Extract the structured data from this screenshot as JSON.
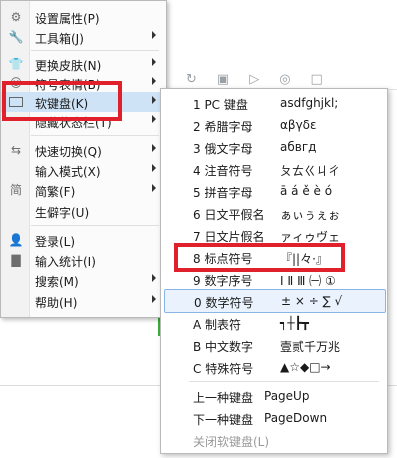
{
  "colors": {
    "highlight": "#e0202b",
    "selected_border": "#8ab4e6",
    "active_bg": "#cfe3f6"
  },
  "main_menu": {
    "items": [
      {
        "icon": "gear-icon",
        "label": "设置属性(P)",
        "submenu": false
      },
      {
        "icon": "wrench-icon",
        "label": "工具箱(J)",
        "submenu": true
      },
      {
        "icon": "shirt-icon",
        "label": "更换皮肤(N)",
        "submenu": true
      },
      {
        "icon": "emoji-icon",
        "label": "符号表情(B)",
        "submenu": true
      },
      {
        "icon": "keyboard-icon",
        "label": "软键盘(K)",
        "submenu": true
      },
      {
        "icon": "",
        "label": "隐藏状态栏(T)",
        "submenu": true
      },
      {
        "icon": "switch-arrows-icon",
        "label": "快速切换(Q)",
        "submenu": true
      },
      {
        "icon": "",
        "label": "输入模式(X)",
        "submenu": true
      },
      {
        "icon": "jian-icon",
        "label": "简繁(F)",
        "submenu": true
      },
      {
        "icon": "",
        "label": "生僻字(U)",
        "submenu": false
      },
      {
        "icon": "user-icon",
        "label": "登录(L)",
        "submenu": false
      },
      {
        "icon": "bar-chart-icon",
        "label": "输入统计(I)",
        "submenu": false
      },
      {
        "icon": "",
        "label": "搜索(M)",
        "submenu": true
      },
      {
        "icon": "",
        "label": "帮助(H)",
        "submenu": true
      }
    ],
    "jian_glyph": "简"
  },
  "keyboard_submenu": {
    "items": [
      {
        "name": "1 PC 键盘",
        "sample": "asdfghjkl;"
      },
      {
        "name": "2 希腊字母",
        "sample": "αβγδε"
      },
      {
        "name": "3 俄文字母",
        "sample": "абвгд"
      },
      {
        "name": "4 注音符号",
        "sample": "ㄆㄊㄍㄐㄔ"
      },
      {
        "name": "5 拼音字母",
        "sample": "ā á ě è ó"
      },
      {
        "name": "6 日文平假名",
        "sample": "ぁぃぅぇぉ"
      },
      {
        "name": "7 日文片假名",
        "sample": "ァィゥヴェ"
      },
      {
        "name": "8 标点符号",
        "sample": "『||々·』"
      },
      {
        "name": "9 数字序号",
        "sample": "Ⅰ Ⅱ Ⅲ ㈠ ①"
      },
      {
        "name": "0 数学符号",
        "sample": "± × ÷ ∑ √"
      },
      {
        "name": "A 制表符",
        "sample": "┑┼┣┳"
      },
      {
        "name": "B 中文数字",
        "sample": "壹贰千万兆"
      },
      {
        "name": "C 特殊符号",
        "sample": "▲☆◆□→"
      }
    ],
    "prev": {
      "name": "上一种键盘",
      "sample": "PageUp"
    },
    "next": {
      "name": "下一种键盘",
      "sample": "PageDown"
    },
    "close": "关闭软键盘(L)"
  }
}
